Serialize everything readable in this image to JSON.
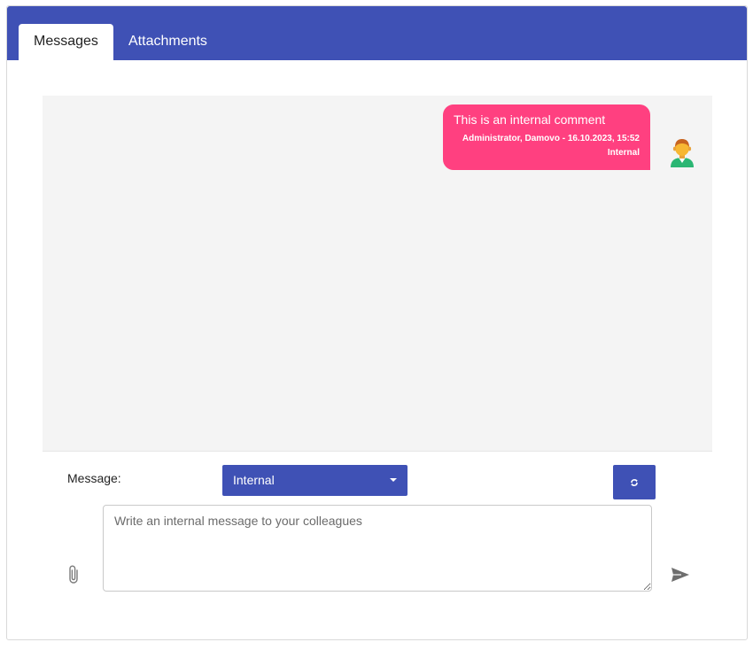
{
  "tabs": [
    {
      "label": "Messages",
      "active": true
    },
    {
      "label": "Attachments",
      "active": false
    }
  ],
  "messages": [
    {
      "text": "This is an internal comment",
      "meta": "Administrator, Damovo - 16.10.2023, 15:52",
      "tag": "Internal",
      "avatar": "user-avatar-icon"
    }
  ],
  "composer": {
    "label": "Message:",
    "type_select": {
      "selected": "Internal"
    },
    "placeholder": "Write an internal message to your colleagues",
    "value": ""
  },
  "icons": {
    "refresh": "refresh-icon",
    "attach": "paperclip-icon",
    "send": "send-icon"
  },
  "colors": {
    "primary": "#3f51b5",
    "bubble": "#ff4080",
    "chat_background": "#f4f4f4"
  }
}
